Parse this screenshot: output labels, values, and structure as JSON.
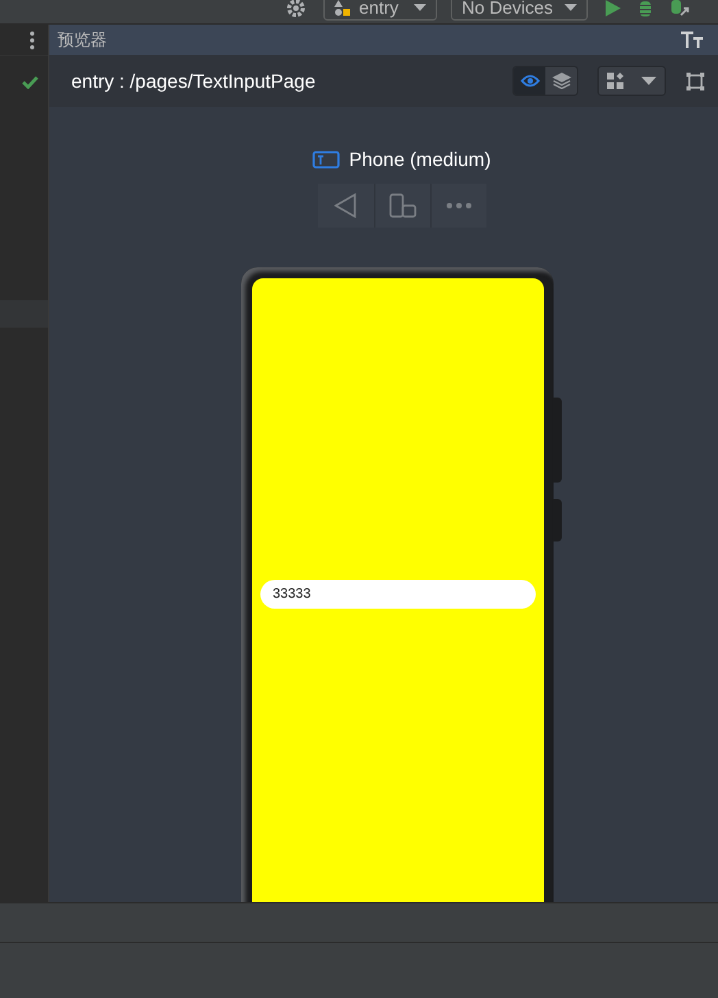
{
  "toolbar": {
    "run_config": "entry",
    "device": "No Devices"
  },
  "preview": {
    "title": "预览器",
    "route": "entry : /pages/TextInputPage",
    "view_modes": [
      {
        "kind": "inspect",
        "selected": true
      },
      {
        "kind": "layers",
        "selected": false
      }
    ],
    "device_name": "Phone (medium)"
  },
  "app_screen": {
    "input_value": "33333"
  }
}
